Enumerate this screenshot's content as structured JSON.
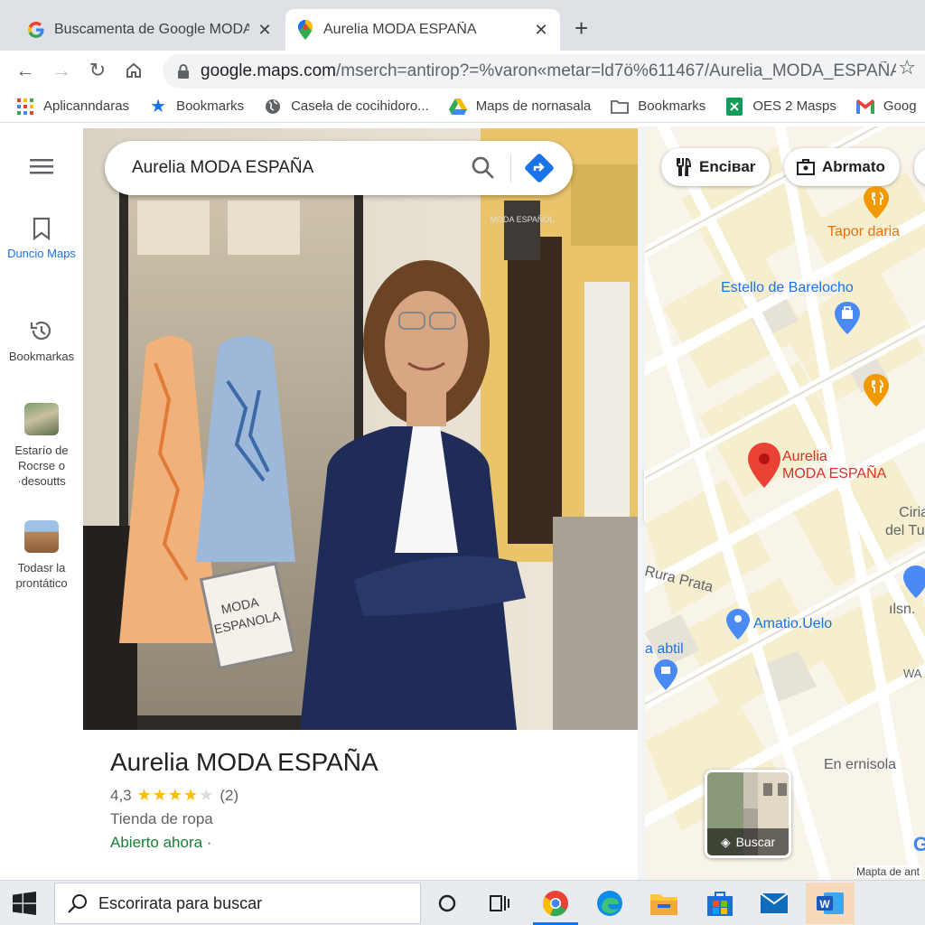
{
  "browser": {
    "tabs": [
      {
        "title": "Buscamenta de Google MODA ·",
        "favicon": "google-g-icon",
        "active": false
      },
      {
        "title": "Aurelia MODA ESPAÑA",
        "favicon": "maps-pin-icon",
        "active": true
      }
    ],
    "url_host": "google.com",
    "url_prefix": "google.maps.com",
    "url_path": "/mserch=antirop?=%varon«metar=ld7ö%611467/Aurelia_MODA_ESPAÑA...",
    "bookmarks": [
      {
        "label": "Aplicanndaras",
        "icon": "apps-grid-icon"
      },
      {
        "label": "Bookmarks",
        "icon": "star-icon"
      },
      {
        "label": "Caseła de cocihidoro...",
        "icon": "globe-icon"
      },
      {
        "label": "Maps de nornasala",
        "icon": "drive-icon"
      },
      {
        "label": "Bookmarks",
        "icon": "folder-icon"
      },
      {
        "label": "OES 2 Masps",
        "icon": "sheets-icon"
      },
      {
        "label": "Goog",
        "icon": "gmail-icon"
      }
    ]
  },
  "rail": {
    "items": [
      {
        "label": "Duncio Maps",
        "icon": "bookmark-icon"
      },
      {
        "label": "Bookmarkas",
        "icon": "history-icon"
      },
      {
        "label": "Estarío de Rocrse o ·desoutts",
        "icon": "place-thumbnail"
      },
      {
        "label": "Todasr la prontático",
        "icon": "place-thumbnail"
      }
    ]
  },
  "search": {
    "query": "Aurelia MODA ESPAÑA"
  },
  "place": {
    "name": "Aurelia MODA ESPAÑA",
    "rating": "4,3",
    "rating_value": 4.3,
    "reviews": "(2)",
    "category": "Tienda de ropa",
    "status": "Abierto ahora",
    "status_suffix": "·",
    "window_sign_line1": "MODA",
    "window_sign_line2": "ESPANOLA",
    "shop_sign": "MODA ESPAÑOL"
  },
  "map": {
    "chips": [
      {
        "label": "Enciвar",
        "icon": "fork-knife-icon"
      },
      {
        "label": "Abrmato",
        "icon": "briefcase-icon"
      }
    ],
    "labels": {
      "tapor": "Tapor daria",
      "estello": "Estello de Barelocho",
      "aurelia_line1": "Aurelia",
      "aurelia_line2": "MODA ESPAÑA",
      "ciriat_line1": "Ciriat",
      "ciriat_line2": "del Tug",
      "rura": "Rura Prata",
      "amatio": "Amatio.Uelo",
      "ilsn": "ılsn.",
      "abtil": "a abtil",
      "wa": "WA",
      "en": "En ernisola",
      "layers": "Buscar",
      "map_data": "Mapta de ant",
      "google": "G"
    },
    "colors": {
      "water": "#aadaff",
      "road": "#ffffff",
      "block": "#f6efcf",
      "pin_red": "#ea4335",
      "poi_orange": "#f29900",
      "poi_blue": "#4a8af4"
    }
  },
  "taskbar": {
    "search_placeholder": "Escorirata para buscar",
    "apps": [
      "task-view-icon",
      "chrome-icon",
      "edge-icon",
      "file-explorer-icon",
      "store-icon",
      "mail-icon",
      "word-icon"
    ]
  }
}
